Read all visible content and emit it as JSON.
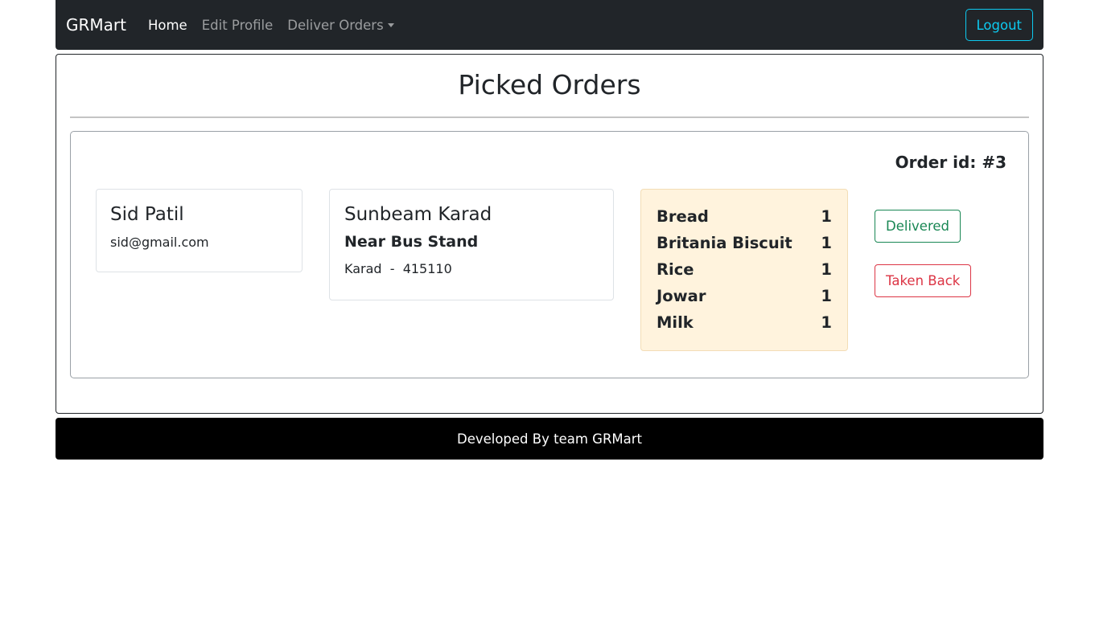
{
  "navbar": {
    "brand": "GRMart",
    "links": [
      {
        "label": "Home",
        "active": true
      },
      {
        "label": "Edit Profile",
        "active": false
      },
      {
        "label": "Deliver Orders",
        "active": false,
        "dropdown": true
      }
    ],
    "logout_label": "Logout"
  },
  "page": {
    "title": "Picked Orders"
  },
  "order": {
    "id_text": "Order id: #3",
    "customer": {
      "name": "Sid Patil",
      "email": "sid@gmail.com"
    },
    "address": {
      "line1": "Sunbeam Karad",
      "line2": "Near Bus Stand",
      "city": "Karad",
      "separator": "-",
      "pincode": "415110"
    },
    "items": [
      {
        "name": "Bread",
        "qty": "1"
      },
      {
        "name": "Britania Biscuit",
        "qty": "1"
      },
      {
        "name": "Rice",
        "qty": "1"
      },
      {
        "name": "Jowar",
        "qty": "1"
      },
      {
        "name": "Milk",
        "qty": "1"
      }
    ],
    "actions": {
      "delivered_label": "Delivered",
      "taken_back_label": "Taken Back"
    }
  },
  "footer": {
    "text": "Developed By team GRMart"
  },
  "colors": {
    "navbar_bg": "#212529",
    "logout_accent": "#0dcaf0",
    "delivered": "#198754",
    "taken_back": "#dc3545",
    "items_bg": "#fff3dd",
    "footer_bg": "#000000"
  }
}
